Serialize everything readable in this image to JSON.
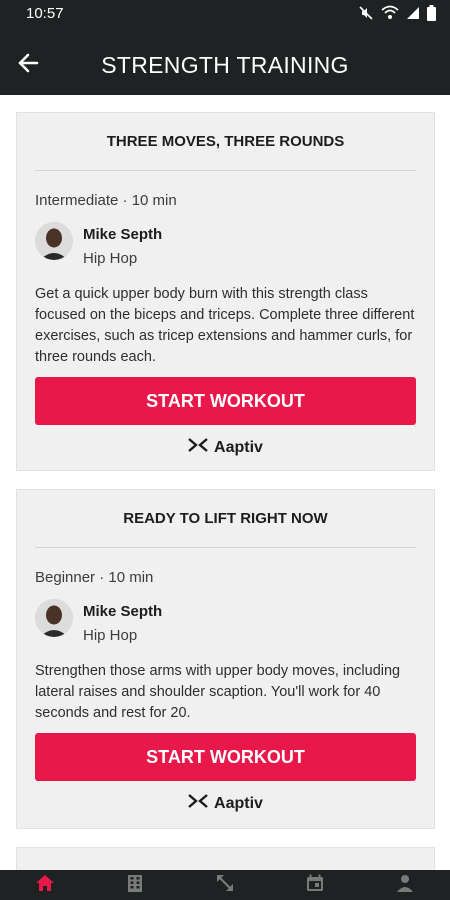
{
  "status_bar": {
    "time": "10:57"
  },
  "header": {
    "title": "STRENGTH TRAINING"
  },
  "cards": [
    {
      "title": "THREE MOVES, THREE ROUNDS",
      "meta": "Intermediate · 10 min",
      "trainer": "Mike Septh",
      "genre": "Hip Hop",
      "description": "Get a quick upper body burn with this strength class focused on the biceps and triceps. Complete three different exercises, such as tricep extensions and hammer curls, for three rounds each.",
      "button_label": "START WORKOUT",
      "brand": "Aaptiv"
    },
    {
      "title": "READY TO LIFT RIGHT NOW",
      "meta": "Beginner · 10 min",
      "trainer": "Mike Septh",
      "genre": "Hip Hop",
      "description": "Strengthen those arms with upper body moves, including lateral raises and shoulder scaption. You'll work for 40 seconds and rest for 20.",
      "button_label": "START WORKOUT",
      "brand": "Aaptiv"
    }
  ],
  "bottom_nav": {
    "items": [
      {
        "icon": "home-icon",
        "active": true
      },
      {
        "icon": "building-icon",
        "active": false
      },
      {
        "icon": "expand-arrows-icon",
        "active": false
      },
      {
        "icon": "calendar-icon",
        "active": false
      },
      {
        "icon": "person-icon",
        "active": false
      }
    ]
  },
  "colors": {
    "accent": "#e8194a",
    "bar": "#1e2222",
    "card": "#f0f0f0"
  }
}
